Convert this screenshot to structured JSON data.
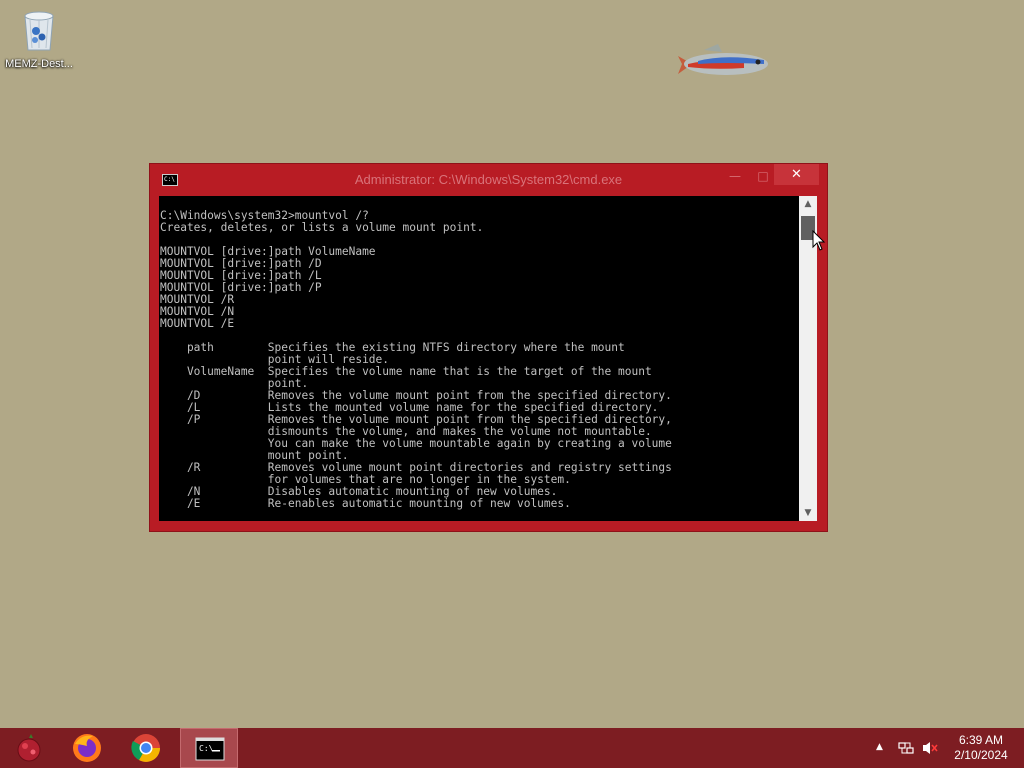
{
  "desktop": {
    "icons": [
      {
        "label": "MEMZ-Dest...",
        "icon": "recycle-bin-icon"
      }
    ]
  },
  "window": {
    "title": "Administrator: C:\\Windows\\System32\\cmd.exe",
    "title_icon_text": "C:\\",
    "minimize_glyph": "—",
    "maximize_glyph": "□",
    "close_glyph": "✕",
    "console_text": "C:\\Windows\\system32>mountvol /?\nCreates, deletes, or lists a volume mount point.\n\nMOUNTVOL [drive:]path VolumeName\nMOUNTVOL [drive:]path /D\nMOUNTVOL [drive:]path /L\nMOUNTVOL [drive:]path /P\nMOUNTVOL /R\nMOUNTVOL /N\nMOUNTVOL /E\n\n    path        Specifies the existing NTFS directory where the mount\n                point will reside.\n    VolumeName  Specifies the volume name that is the target of the mount\n                point.\n    /D          Removes the volume mount point from the specified directory.\n    /L          Lists the mounted volume name for the specified directory.\n    /P          Removes the volume mount point from the specified directory,\n                dismounts the volume, and makes the volume not mountable.\n                You can make the volume mountable again by creating a volume\n                mount point.\n    /R          Removes volume mount point directories and registry settings\n                for volumes that are no longer in the system.\n    /N          Disables automatic mounting of new volumes.\n    /E          Re-enables automatic mounting of new volumes.",
    "scroll_up_glyph": "▲",
    "scroll_down_glyph": "▼"
  },
  "taskbar": {
    "items": [
      {
        "icon": "memz-icon"
      },
      {
        "icon": "firefox-icon"
      },
      {
        "icon": "chrome-icon"
      },
      {
        "icon": "cmd-icon",
        "active": true
      }
    ],
    "tray": {
      "arrow_glyph": "▲",
      "network_icon": "network-icon",
      "volume_icon": "volume-muted-icon"
    },
    "clock": {
      "time": "6:39 AM",
      "date": "2/10/2024"
    }
  },
  "colors": {
    "desktop": "#b1a887",
    "window_frame": "#b81c24",
    "close_button": "#c7333a",
    "console_bg": "#000000",
    "console_text": "#c0c0c0",
    "taskbar": "#7d1d22"
  }
}
